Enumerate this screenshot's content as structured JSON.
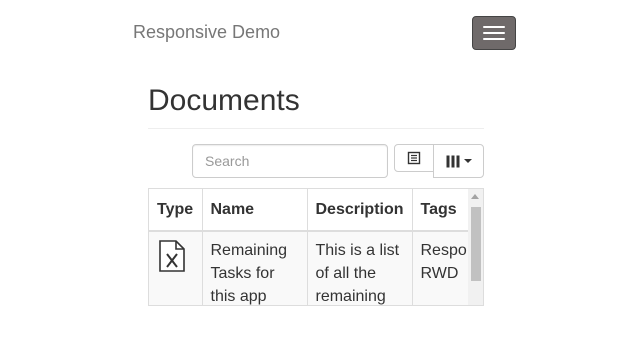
{
  "navbar": {
    "brand": "Responsive Demo",
    "toggle_icon": "hamburger-menu-icon"
  },
  "page": {
    "title": "Documents"
  },
  "toolbar": {
    "search_placeholder": "Search",
    "list_view_icon": "list-view-icon",
    "columns_icon": "columns-icon"
  },
  "table": {
    "headers": {
      "type": "Type",
      "name": "Name",
      "description": "Description",
      "tags": "Tags"
    },
    "rows": [
      {
        "type_icon": "excel-file-icon",
        "name": "Remaining Tasks for this app",
        "description": "This is a list of all the remaining",
        "tags_line1": "Respo",
        "tags_line2": "RWD"
      }
    ]
  }
}
